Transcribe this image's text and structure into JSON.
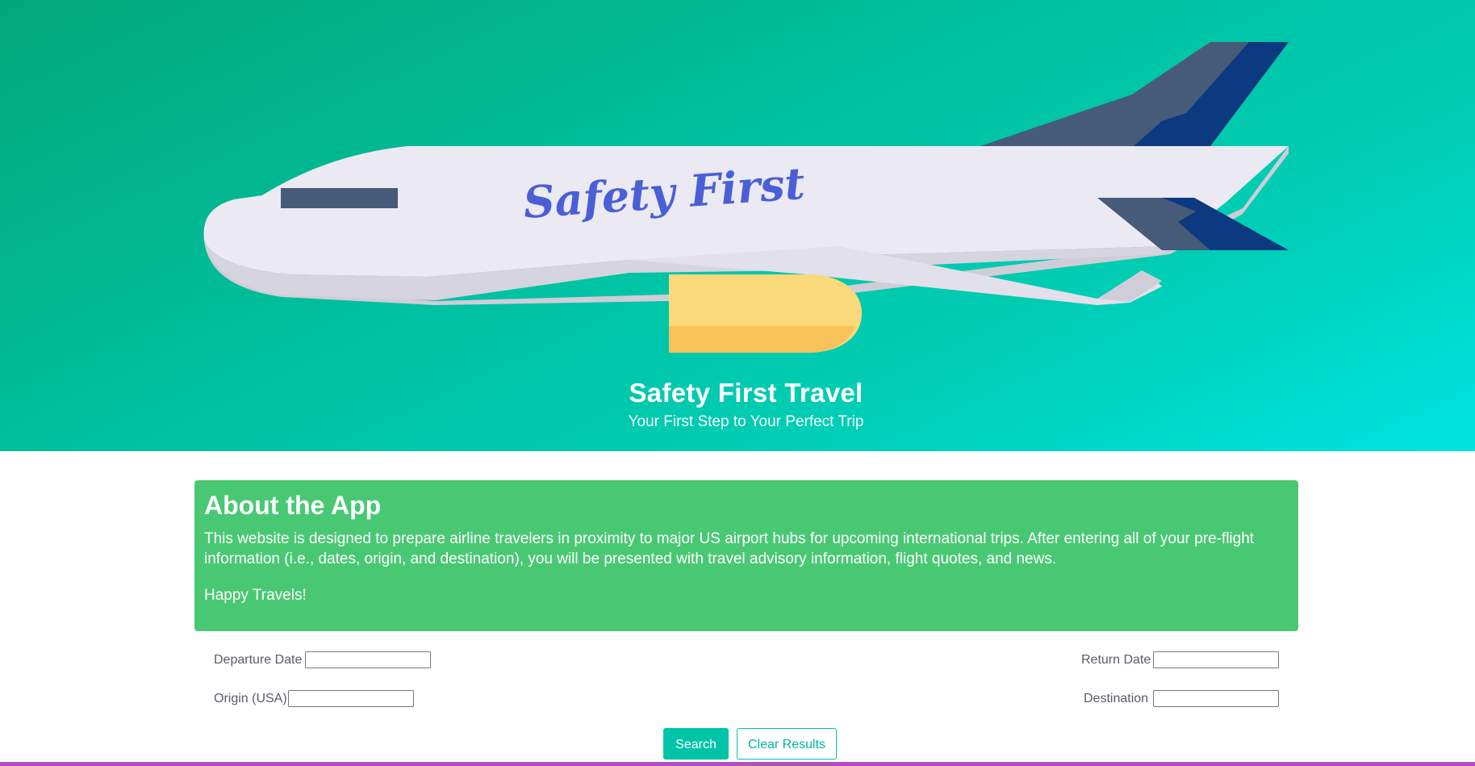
{
  "hero": {
    "logo_text": "Safety First",
    "title": "Safety First Travel",
    "subtitle": "Your First Step to Your Perfect Trip"
  },
  "about": {
    "heading": "About the App",
    "description": "This website is designed to prepare airline travelers in proximity to major US airport hubs for upcoming international trips. After entering all of your pre-flight information (i.e., dates, origin, and destination), you will be presented with travel advisory information, flight quotes, and news.",
    "closing": "Happy Travels!"
  },
  "form": {
    "departure_label": "Departure Date",
    "departure_value": "",
    "return_label": "Return Date",
    "return_value": "",
    "origin_label": "Origin (USA)",
    "origin_value": "",
    "destination_label": "Destination",
    "destination_value": ""
  },
  "buttons": {
    "search_label": "Search",
    "clear_label": "Clear Results"
  },
  "colors": {
    "hero_gradient_start": "#02a87a",
    "hero_gradient_end": "#00e3e0",
    "about_background": "#49c873",
    "button_accent": "#00c4a7",
    "plane_body": "#ebe9f2",
    "plane_tail": "#0c3a80",
    "plane_logo": "#4a5fd6",
    "engine": "#f9d97a",
    "bottom_bar": "#b04fc0"
  }
}
